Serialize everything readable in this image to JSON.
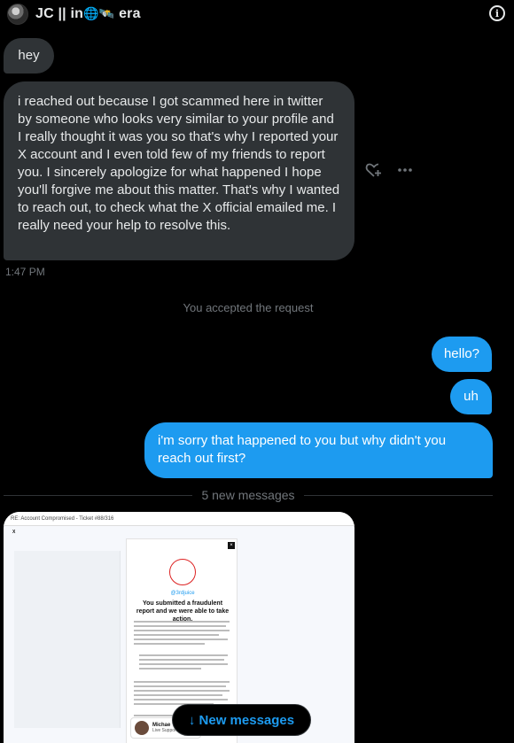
{
  "header": {
    "name_prefix": "JC || in",
    "name_suffix": "era",
    "emoji_globe": "🌐",
    "emoji_satellite": "🛰️",
    "info_icon": "info-icon"
  },
  "messages": {
    "m1": "hey",
    "m2": "i  reached out because I got scammed here in twitter by someone who looks very similar to your profile and I really thought it was you so that's why I reported your X account and I even told few of my friends to report you. I sincerely apologize for what happened I hope you'll forgive me about this matter. That's why I wanted to reach out, to check what the X official emailed me. I really need your help to resolve this.",
    "m2_time": "1:47 PM",
    "system": "You accepted the request",
    "m3": "hello?",
    "m4": "uh",
    "m5": "i'm sorry that happened to you but why didn't you reach out first?"
  },
  "divider": {
    "label": "5 new messages"
  },
  "attachment": {
    "subject": "RE: Account Compromised - Ticket #88/316",
    "sender": "X",
    "handle": "@3rdjuice",
    "heading": "You submitted a fraudulent report and we were able to take action.",
    "profile_name": "Michae",
    "profile_sub": "Live Support"
  },
  "new_messages_button": {
    "label": "↓ New messages"
  },
  "colors": {
    "incoming": "#2f3336",
    "outgoing": "#1d9bf0",
    "background": "#000000",
    "muted": "#71767b"
  }
}
